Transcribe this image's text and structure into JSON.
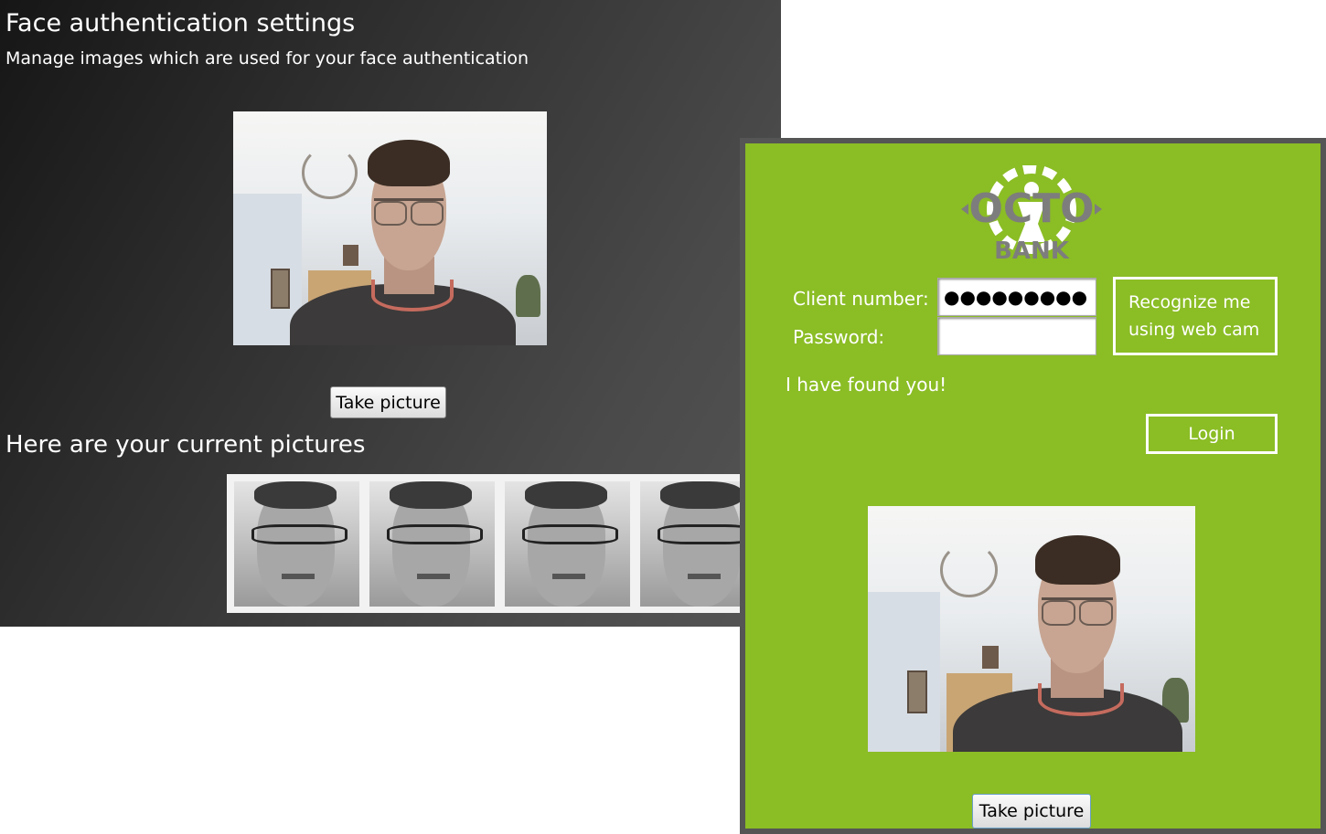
{
  "settings": {
    "title": "Face authentication settings",
    "subtitle": "Manage images which are used for your face authentication",
    "take_picture_label": "Take picture",
    "pictures_heading": "Here are your current pictures",
    "thumbnail_count": 4
  },
  "login": {
    "logo_text_top": "OCTO",
    "logo_text_bottom": "BANK",
    "client_number_label": "Client number:",
    "client_number_value": "●●●●●●●●●",
    "password_label": "Password:",
    "password_value": "",
    "recognize_label_line1": "Recognize me",
    "recognize_label_line2": "using web cam",
    "status_text": "I have found you!",
    "login_label": "Login",
    "take_picture_label": "Take picture"
  },
  "colors": {
    "login_background": "#8bbd25",
    "login_border": "#555555",
    "settings_background": "#2f2f2f"
  }
}
